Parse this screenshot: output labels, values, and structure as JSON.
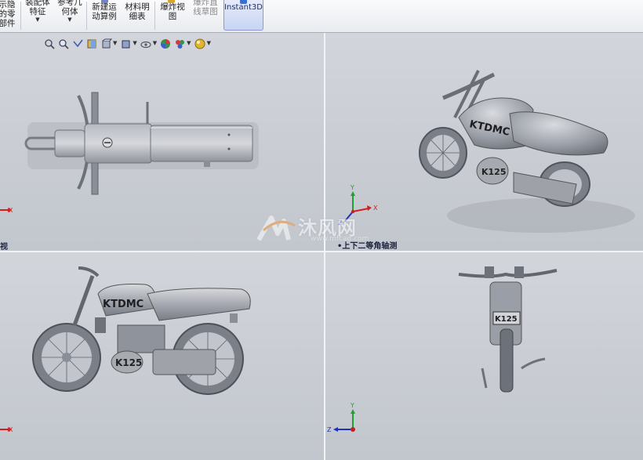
{
  "toolbar": {
    "buttons": [
      {
        "label": "示隐\n的零\n部件"
      },
      {
        "label": "装配体\n特征"
      },
      {
        "label": "参考几\n何体"
      },
      {
        "label": "新建运\n动算例"
      },
      {
        "label": "材料明\n细表"
      },
      {
        "label": "爆炸视\n图"
      },
      {
        "label": "爆炸直\n线草图"
      },
      {
        "label": "Instant3D"
      }
    ]
  },
  "viewports": {
    "top_left_label": "视",
    "top_right_label": "•上下二等角轴测"
  },
  "heads_up_icons": [
    "zoom-to-fit-icon",
    "zoom-area-icon",
    "previous-view-icon",
    "section-view-icon",
    "view-orientation-icon",
    "display-style-icon",
    "hide-show-items-icon",
    "edit-appearance-icon",
    "apply-scene-icon",
    "view-settings-icon"
  ],
  "model": {
    "brand_text": "KTDMC",
    "plate_text": "K125"
  },
  "triad": {
    "x": "X",
    "y": "Y",
    "z": "Z"
  },
  "watermark": {
    "text": "沐风网",
    "url": "www.mfcad.com"
  },
  "colors": {
    "viewport_bg": "#c9ccd3",
    "model_gray": "#8e919a",
    "triad_x": "#d02020",
    "triad_y": "#20a030",
    "triad_z": "#2030c0"
  }
}
